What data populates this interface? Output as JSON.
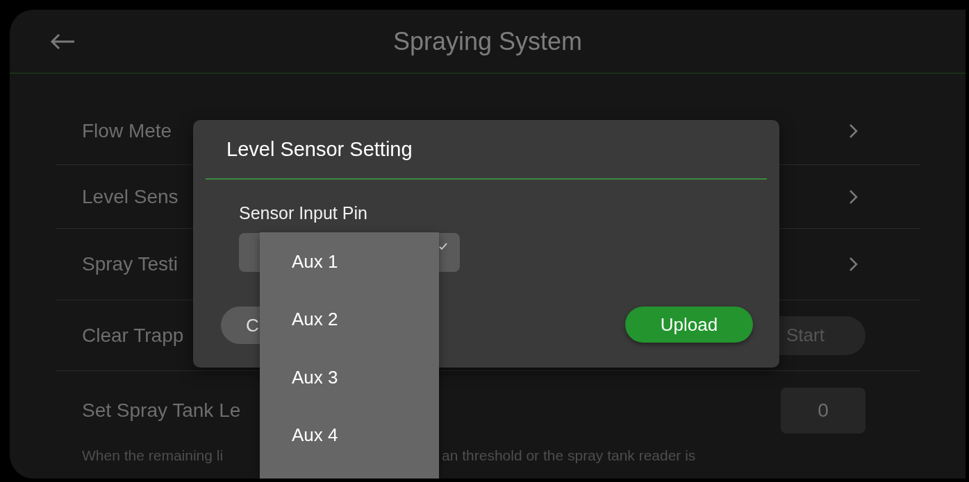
{
  "header": {
    "title": "Spraying System"
  },
  "settings": [
    {
      "kind": "link",
      "label": "Flow Mete"
    },
    {
      "kind": "link",
      "label": "Level Sens"
    },
    {
      "kind": "link",
      "label": "Spray Testi"
    },
    {
      "kind": "action",
      "label": "Clear Trapp",
      "button": "Start"
    },
    {
      "kind": "input",
      "label": "Set Spray Tank Le",
      "value": "0",
      "description": [
        "When the remaining li",
        "an threshold or the spray tank reader is"
      ]
    }
  ],
  "dialog": {
    "title": "Level Sensor Setting",
    "field_label": "Sensor Input Pin",
    "buttons": [
      {
        "kind": "cancel",
        "label": "C"
      },
      {
        "kind": "primary",
        "label": "Upload"
      }
    ]
  },
  "dropdown": {
    "options": [
      "Aux 1",
      "Aux 2",
      "Aux 3",
      "Aux 4"
    ]
  }
}
